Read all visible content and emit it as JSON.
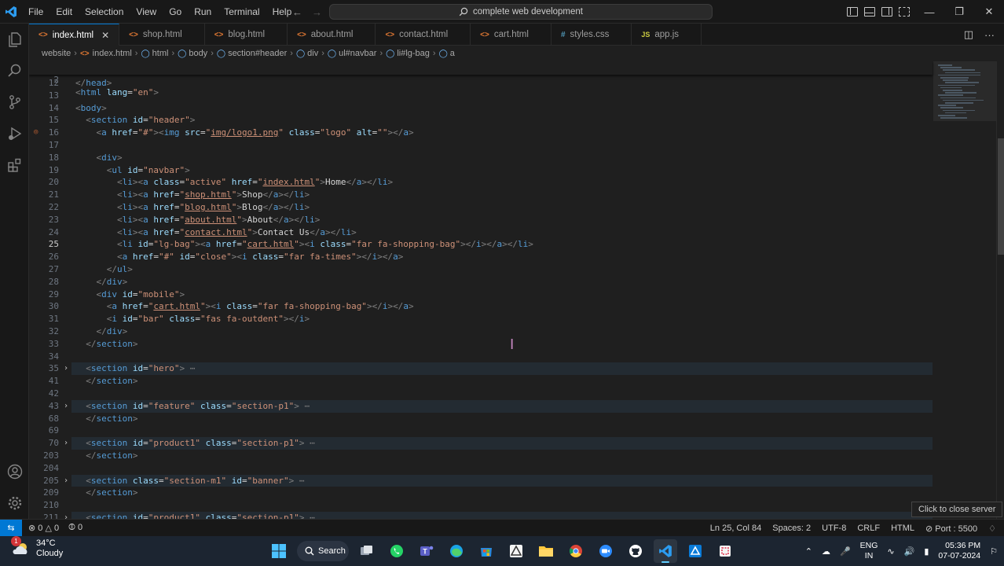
{
  "menu": [
    "File",
    "Edit",
    "Selection",
    "View",
    "Go",
    "Run",
    "Terminal",
    "Help"
  ],
  "search": {
    "text": "complete web development"
  },
  "tabs": [
    {
      "label": "index.html",
      "type": "html",
      "active": true
    },
    {
      "label": "shop.html",
      "type": "html"
    },
    {
      "label": "blog.html",
      "type": "html"
    },
    {
      "label": "about.html",
      "type": "html"
    },
    {
      "label": "contact.html",
      "type": "html"
    },
    {
      "label": "cart.html",
      "type": "html"
    },
    {
      "label": "styles.css",
      "type": "css"
    },
    {
      "label": "app.js",
      "type": "js"
    }
  ],
  "breadcrumb": [
    "website",
    "index.html",
    "html",
    "body",
    "section#header",
    "div",
    "ul#navbar",
    "li#lg-bag",
    "a"
  ],
  "editor": {
    "sticky": {
      "ln": "2",
      "code": "<html lang=\"en\">"
    },
    "lines": [
      {
        "ln": "12",
        "code": "</head>"
      },
      {
        "ln": "13",
        "code": ""
      },
      {
        "ln": "14",
        "code": "<body>"
      },
      {
        "ln": "15",
        "code": "  <section id=\"header\">"
      },
      {
        "ln": "16",
        "code": "    <a href=\"#\"><img src=\"img/logo1.png\" class=\"logo\" alt=\"\"></a>"
      },
      {
        "ln": "17",
        "code": ""
      },
      {
        "ln": "18",
        "code": "    <div>"
      },
      {
        "ln": "19",
        "code": "      <ul id=\"navbar\">"
      },
      {
        "ln": "20",
        "code": "        <li><a class=\"active\" href=\"index.html\">Home</a></li>"
      },
      {
        "ln": "21",
        "code": "        <li><a href=\"shop.html\">Shop</a></li>"
      },
      {
        "ln": "22",
        "code": "        <li><a href=\"blog.html\">Blog</a></li>"
      },
      {
        "ln": "23",
        "code": "        <li><a href=\"about.html\">About</a></li>"
      },
      {
        "ln": "24",
        "code": "        <li><a href=\"contact.html\">Contact Us</a></li>"
      },
      {
        "ln": "25",
        "code": "        <li id=\"lg-bag\"><a href=\"cart.html\"><i class=\"far fa-shopping-bag\"></i></a></li>"
      },
      {
        "ln": "26",
        "code": "        <a href=\"#\" id=\"close\"><i class=\"far fa-times\"></i></a>"
      },
      {
        "ln": "27",
        "code": "      </ul>"
      },
      {
        "ln": "28",
        "code": "    </div>"
      },
      {
        "ln": "29",
        "code": "    <div id=\"mobile\">"
      },
      {
        "ln": "30",
        "code": "      <a href=\"cart.html\"><i class=\"far fa-shopping-bag\"></i></a>"
      },
      {
        "ln": "31",
        "code": "      <i id=\"bar\" class=\"fas fa-outdent\"></i>"
      },
      {
        "ln": "32",
        "code": "    </div>"
      },
      {
        "ln": "33",
        "code": "  </section>"
      },
      {
        "ln": "34",
        "code": ""
      },
      {
        "ln": "35",
        "code": "  <section id=\"hero\">",
        "folded": true
      },
      {
        "ln": "41",
        "code": "  </section>"
      },
      {
        "ln": "42",
        "code": ""
      },
      {
        "ln": "43",
        "code": "  <section id=\"feature\" class=\"section-p1\">",
        "folded": true
      },
      {
        "ln": "68",
        "code": "  </section>"
      },
      {
        "ln": "69",
        "code": ""
      },
      {
        "ln": "70",
        "code": "  <section id=\"product1\" class=\"section-p1\">",
        "folded": true
      },
      {
        "ln": "203",
        "code": "  </section>"
      },
      {
        "ln": "204",
        "code": ""
      },
      {
        "ln": "205",
        "code": "  <section class=\"section-m1\" id=\"banner\">",
        "folded": true
      },
      {
        "ln": "209",
        "code": "  </section>"
      },
      {
        "ln": "210",
        "code": ""
      },
      {
        "ln": "211",
        "code": "  <section id=\"product1\" class=\"section-p1\">",
        "folded": true
      }
    ]
  },
  "tooltip": "Click to close server",
  "status": {
    "errors": "0",
    "warnings": "0",
    "ports": "0",
    "position": "Ln 25, Col 84",
    "spaces": "Spaces: 2",
    "encoding": "UTF-8",
    "eol": "CRLF",
    "language": "HTML",
    "server": "Port : 5500"
  },
  "taskbar": {
    "weather_temp": "34°C",
    "weather_desc": "Cloudy",
    "weather_badge": "1",
    "search_label": "Search",
    "lang_1": "ENG",
    "lang_2": "IN",
    "time": "05:36 PM",
    "date": "07-07-2024"
  },
  "colors": {
    "accent": "#0078d4",
    "tag": "#569cd6",
    "attr": "#9cdcfe",
    "string": "#ce9178",
    "statusbar": "#181818"
  }
}
